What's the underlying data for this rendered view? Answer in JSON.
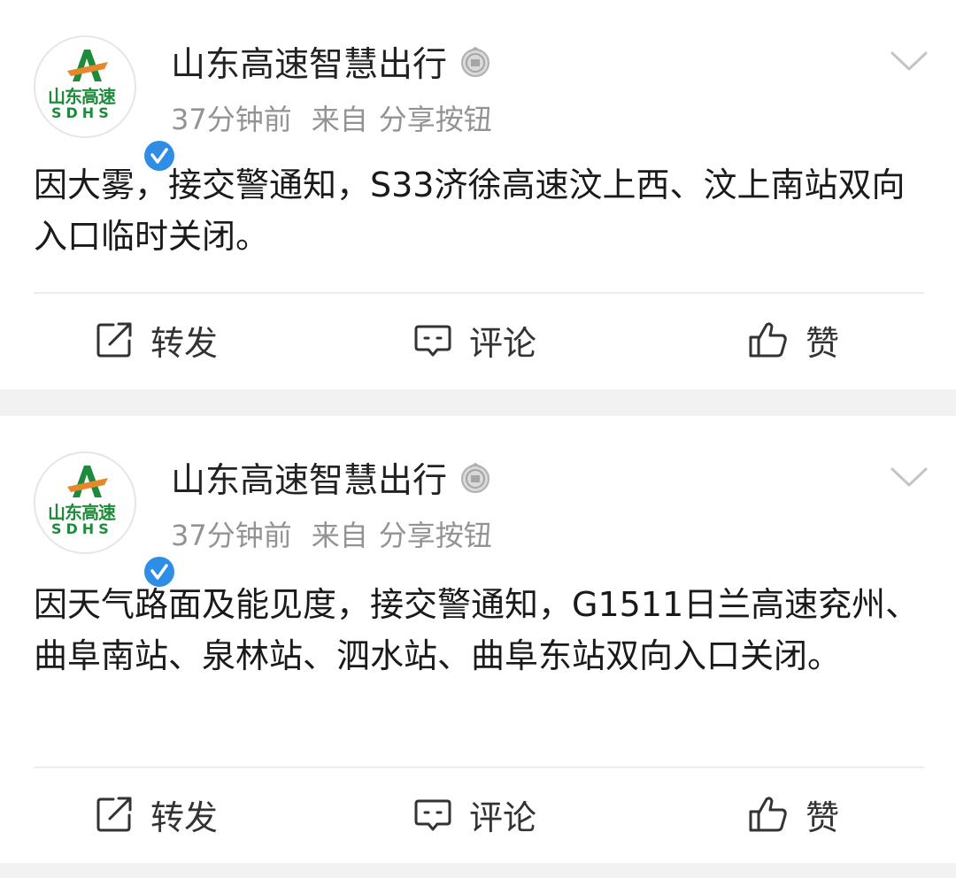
{
  "posts": [
    {
      "account_name": "山东高速智慧出行",
      "avatar_logo_text": "山东高速",
      "avatar_logo_sub": "SDHS",
      "time": "37分钟前",
      "source_prefix": "来自",
      "source": "分享按钮",
      "content": "因大雾，接交警通知，S33济徐高速汶上西、汶上南站双向入口临时关闭。",
      "actions": {
        "repost_label": "转发",
        "comment_label": "评论",
        "like_label": "赞"
      }
    },
    {
      "account_name": "山东高速智慧出行",
      "avatar_logo_text": "山东高速",
      "avatar_logo_sub": "SDHS",
      "time": "37分钟前",
      "source_prefix": "来自",
      "source": "分享按钮",
      "content": "因天气路面及能见度，接交警通知，G1511日兰高速兖州、曲阜南站、泉林站、泗水站、曲阜东站双向入口关闭。",
      "actions": {
        "repost_label": "转发",
        "comment_label": "评论",
        "like_label": "赞"
      }
    }
  ],
  "colors": {
    "text": "#1a1a1a",
    "meta": "#939393",
    "verified": "#2e8ee5",
    "logo_green": "#1e8b3a",
    "logo_orange": "#e8862b",
    "separator_bg": "#f2f2f2"
  },
  "icons": {
    "repost": "repost-icon",
    "comment": "comment-icon",
    "like": "thumbs-up-icon",
    "verified": "verified-badge-icon",
    "medal": "medal-icon",
    "menu": "chevron-down-icon"
  }
}
